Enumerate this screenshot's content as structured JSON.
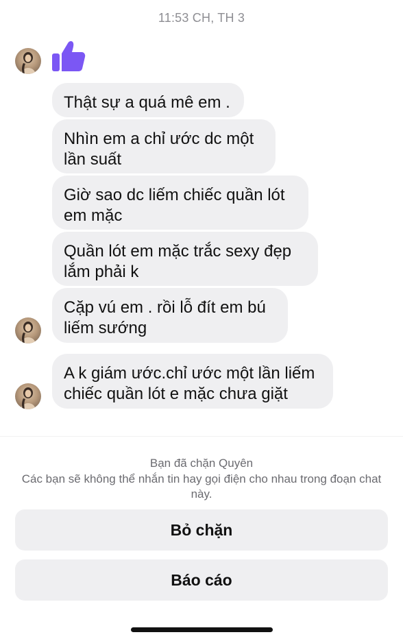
{
  "header": {
    "timestamp": "11:53 CH, TH 3"
  },
  "conversation": {
    "like_reaction": "thumbs-up-icon",
    "accent_color": "#7b57f4",
    "messages": [
      {
        "text": "Thật sự a quá mê em ."
      },
      {
        "text": "Nhìn em a chỉ ước dc một\nlần suất"
      },
      {
        "text": "Giờ sao dc liếm chiếc quần lót\nem mặc"
      },
      {
        "text": "Quần lót em mặc trắc sexy đẹp\nlắm phải k"
      },
      {
        "text": "Cặp vú em . rồi lỗ đít em bú\nliếm sướng"
      },
      {
        "text": "A k giám ước.chỉ ước một lần liếm\nchiếc quần lót e mặc chưa giặt"
      }
    ]
  },
  "block_notice": {
    "title": "Bạn đã chặn Quyên",
    "description": "Các bạn sẽ không thể nhắn tin hay gọi điện cho nhau trong đoạn chat này."
  },
  "actions": {
    "unblock_label": "Bỏ chặn",
    "report_label": "Báo cáo"
  }
}
